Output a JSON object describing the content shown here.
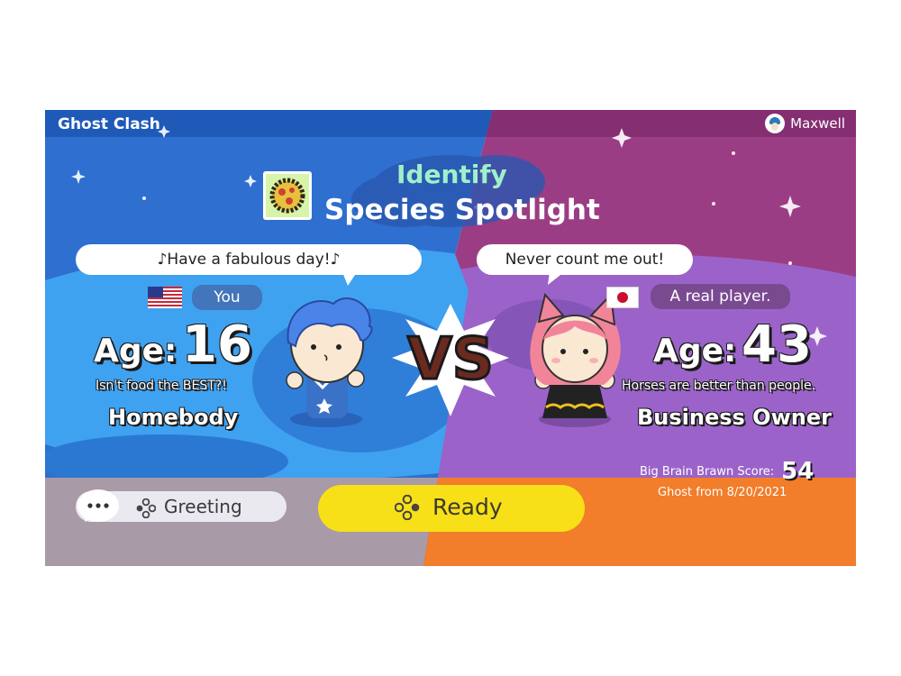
{
  "header": {
    "title": "Ghost Clash",
    "user_name": "Maxwell"
  },
  "game": {
    "mode": "Identify",
    "name": "Species Spotlight"
  },
  "player1": {
    "speech": "♪Have a fabulous day!♪",
    "tag": "You",
    "age_label": "Age:",
    "age": "16",
    "motto": "Isn't food the BEST?!",
    "occupation": "Homebody"
  },
  "player2": {
    "speech": "Never count me out!",
    "tag": "A real player.",
    "age_label": "Age:",
    "age": "43",
    "motto": "Horses are better than people.",
    "occupation": "Business Owner",
    "score_label": "Big Brain Brawn Score:",
    "score": "54",
    "ghost_date": "Ghost from 8/20/2021"
  },
  "versus": "VS",
  "buttons": {
    "greeting": "Greeting",
    "ready": "Ready"
  },
  "colors": {
    "left_bg": "#2e6fd0",
    "right_bg": "#9b3d85",
    "ready_button": "#f7e018",
    "bottom_left": "#a99aa8",
    "bottom_right": "#f27d2a"
  },
  "icons": {
    "user": "avatar-icon",
    "flag_p1": "us-flag-icon",
    "flag_p2": "japan-flag-icon",
    "button_glyph": "dpad-buttons-icon",
    "chat": "speech-dots-icon",
    "game": "pizza-icon"
  }
}
